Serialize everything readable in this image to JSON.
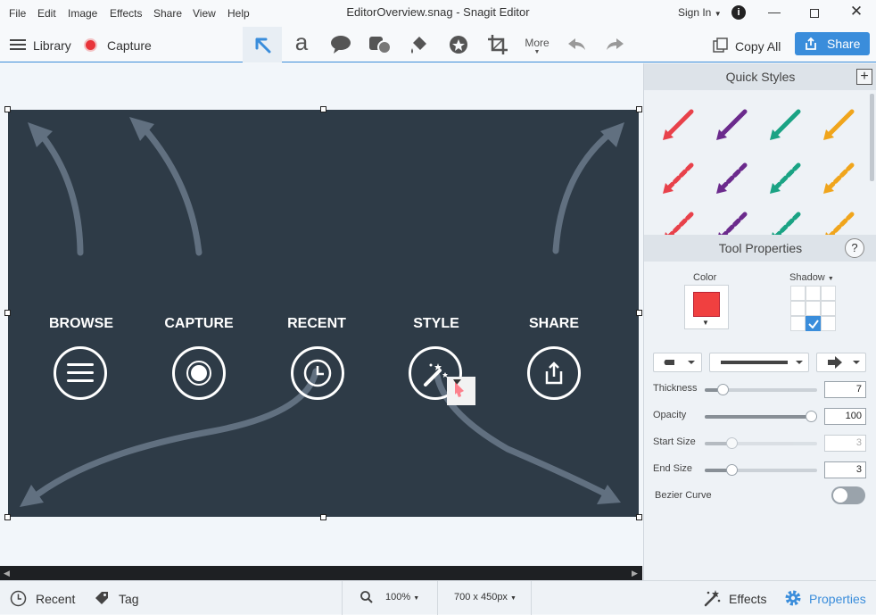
{
  "menu": [
    "File",
    "Edit",
    "Image",
    "Effects",
    "Share",
    "View",
    "Help"
  ],
  "window_title": "EditorOverview.snag - Snagit Editor",
  "signin_label": "Sign In",
  "toolbar": {
    "library_label": "Library",
    "capture_label": "Capture",
    "more_label": "More",
    "copy_all_label": "Copy All",
    "share_label": "Share",
    "tools": [
      "arrow-tool",
      "text-tool",
      "callout-tool",
      "shape-tool",
      "fill-tool",
      "stamp-tool",
      "crop-tool"
    ]
  },
  "canvas": {
    "categories": [
      {
        "label": "BROWSE",
        "icon": "menu-lines-icon"
      },
      {
        "label": "CAPTURE",
        "icon": "record-icon"
      },
      {
        "label": "RECENT",
        "icon": "clock-icon"
      },
      {
        "label": "STYLE",
        "icon": "magic-wand-icon"
      },
      {
        "label": "SHARE",
        "icon": "share-upload-icon"
      }
    ]
  },
  "quick_styles": {
    "title": "Quick Styles",
    "colors": [
      "#e8414a",
      "#6b2a8c",
      "#1aa384",
      "#f0a51c"
    ]
  },
  "tool_properties": {
    "title": "Tool Properties",
    "color_label": "Color",
    "color_value": "#f04040",
    "shadow_label": "Shadow",
    "thickness_label": "Thickness",
    "thickness_value": "7",
    "opacity_label": "Opacity",
    "opacity_value": "100",
    "start_size_label": "Start Size",
    "start_size_value": "3",
    "end_size_label": "End Size",
    "end_size_value": "3",
    "bezier_label": "Bezier Curve"
  },
  "bottom": {
    "recent_label": "Recent",
    "tag_label": "Tag",
    "zoom_value": "100%",
    "size_value": "700 x 450px",
    "effects_label": "Effects",
    "properties_label": "Properties"
  }
}
